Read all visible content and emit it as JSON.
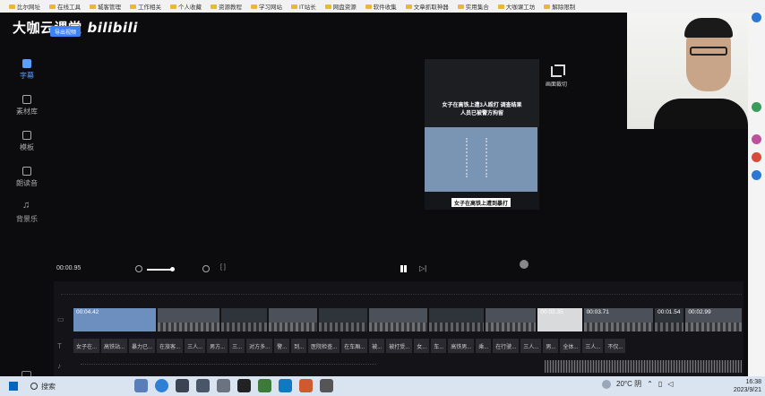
{
  "bookmarks": [
    "比尔网址",
    "在线工具",
    "城客管理",
    "工作相关",
    "个人收藏",
    "资源教程",
    "学习网站",
    "IT站长",
    "网盘资源",
    "软件收集",
    "文章抓取神器",
    "实用集合",
    "大咖课工坊",
    "解除限制"
  ],
  "app": {
    "brand": "大咖云课堂",
    "brand_logo": "bilibili",
    "export_label": "导出视频",
    "sidebar": [
      {
        "label": "字幕",
        "icon": "subtitle-icon",
        "active": true
      },
      {
        "label": "素材库",
        "icon": "cube-icon",
        "active": false
      },
      {
        "label": "模板",
        "icon": "template-icon",
        "active": false
      },
      {
        "label": "朗读音",
        "icon": "voice-icon",
        "active": false
      },
      {
        "label": "背景乐",
        "icon": "music-icon",
        "active": false
      }
    ]
  },
  "preview": {
    "title": "女子在高铁上遭3人殴打 调查结果人员已被警方拘留",
    "caption": "女子在高铁上遭到暴打",
    "reposition_label": "画面裁切"
  },
  "player": {
    "current_time": "00:00.95",
    "fit_label": "[ ]"
  },
  "timeline": {
    "clips": [
      {
        "label": "00:04.42",
        "style": "blue",
        "seconds": 4.42
      },
      {
        "label": "",
        "style": "gray1",
        "seconds": 3.3
      },
      {
        "label": "",
        "style": "gray2",
        "seconds": 2.4
      },
      {
        "label": "",
        "style": "gray1",
        "seconds": 2.6
      },
      {
        "label": "",
        "style": "gray2",
        "seconds": 2.6
      },
      {
        "label": "",
        "style": "gray1",
        "seconds": 3.1
      },
      {
        "label": "",
        "style": "gray2",
        "seconds": 2.9
      },
      {
        "label": "",
        "style": "gray1",
        "seconds": 2.7
      },
      {
        "label": "00:02.35",
        "style": "light",
        "seconds": 2.35
      },
      {
        "label": "00:03.71",
        "style": "gray1",
        "seconds": 3.71
      },
      {
        "label": "00:01.54",
        "style": "gray2",
        "seconds": 1.54
      },
      {
        "label": "00:02.99",
        "style": "gray1",
        "seconds": 2.99
      }
    ],
    "subtitles": [
      "女子在...",
      "高铁站...",
      "暴力已...",
      "在旅客...",
      "三人...",
      "男方...",
      "三...",
      "对方多...",
      "警...",
      "到...",
      "医院检查...",
      "在车厢...",
      "被...",
      "被打受...",
      "女...",
      "车...",
      "高铁男...",
      "乘...",
      "在行驶...",
      "三人...",
      "男...",
      "全体...",
      "三人...",
      "不仅..."
    ]
  },
  "taskbar": {
    "search_label": "搜索",
    "weather": "20°C 阴",
    "time": "16:38",
    "date": "2023/9/21"
  }
}
